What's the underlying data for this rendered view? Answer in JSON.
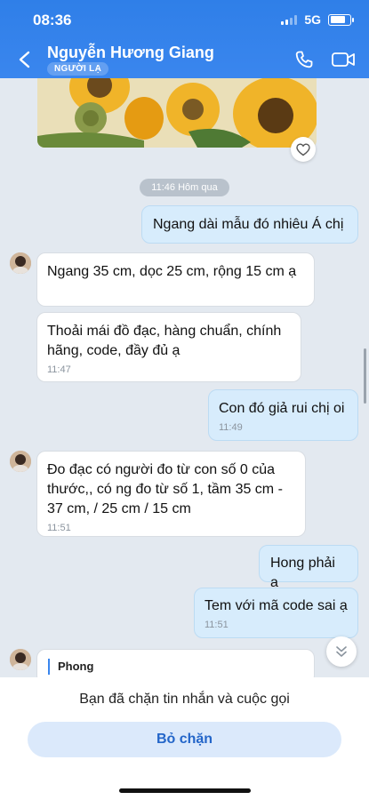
{
  "status": {
    "time": "08:36",
    "network": "5G"
  },
  "header": {
    "name": "Nguyễn Hương Giang",
    "badge": "NGƯỜI LẠ"
  },
  "time_chip": "11:46 Hôm qua",
  "messages": [
    {
      "text": "Ngang dài mẫu đó nhiêu Á chị"
    },
    {
      "text": "Ngang 35  cm,  dọc 25 cm,  rộng 15 cm ạ"
    },
    {
      "text": "Thoải mái đồ đạc, hàng chuẩn, chính hãng,  code,  đầy đủ ạ",
      "time": "11:47"
    },
    {
      "text": "Con đó giả rui chị oi",
      "time": "11:49"
    },
    {
      "text": "Đo đạc có người đo từ con số 0 của thước,, có ng đo từ số 1, tầm 35 cm  - 37 cm,   / 25 cm  / 15 cm",
      "time": "11:51"
    },
    {
      "text": "Hong phải ạ"
    },
    {
      "text": "Tem với mã code sai ạ",
      "time": "11:51"
    }
  ],
  "reply_preview": {
    "name": "Phong"
  },
  "footer": {
    "blocked_text": "Bạn đã chặn tin nhắn và cuộc gọi",
    "unblock_label": "Bỏ chặn"
  },
  "colors": {
    "header": "#3a86ee",
    "outgoing_bubble": "#d7ecfc",
    "accent": "#2466c9"
  },
  "icons": [
    "back-icon",
    "phone-icon",
    "video-call-icon",
    "heart-icon",
    "chevron-down-icon"
  ]
}
